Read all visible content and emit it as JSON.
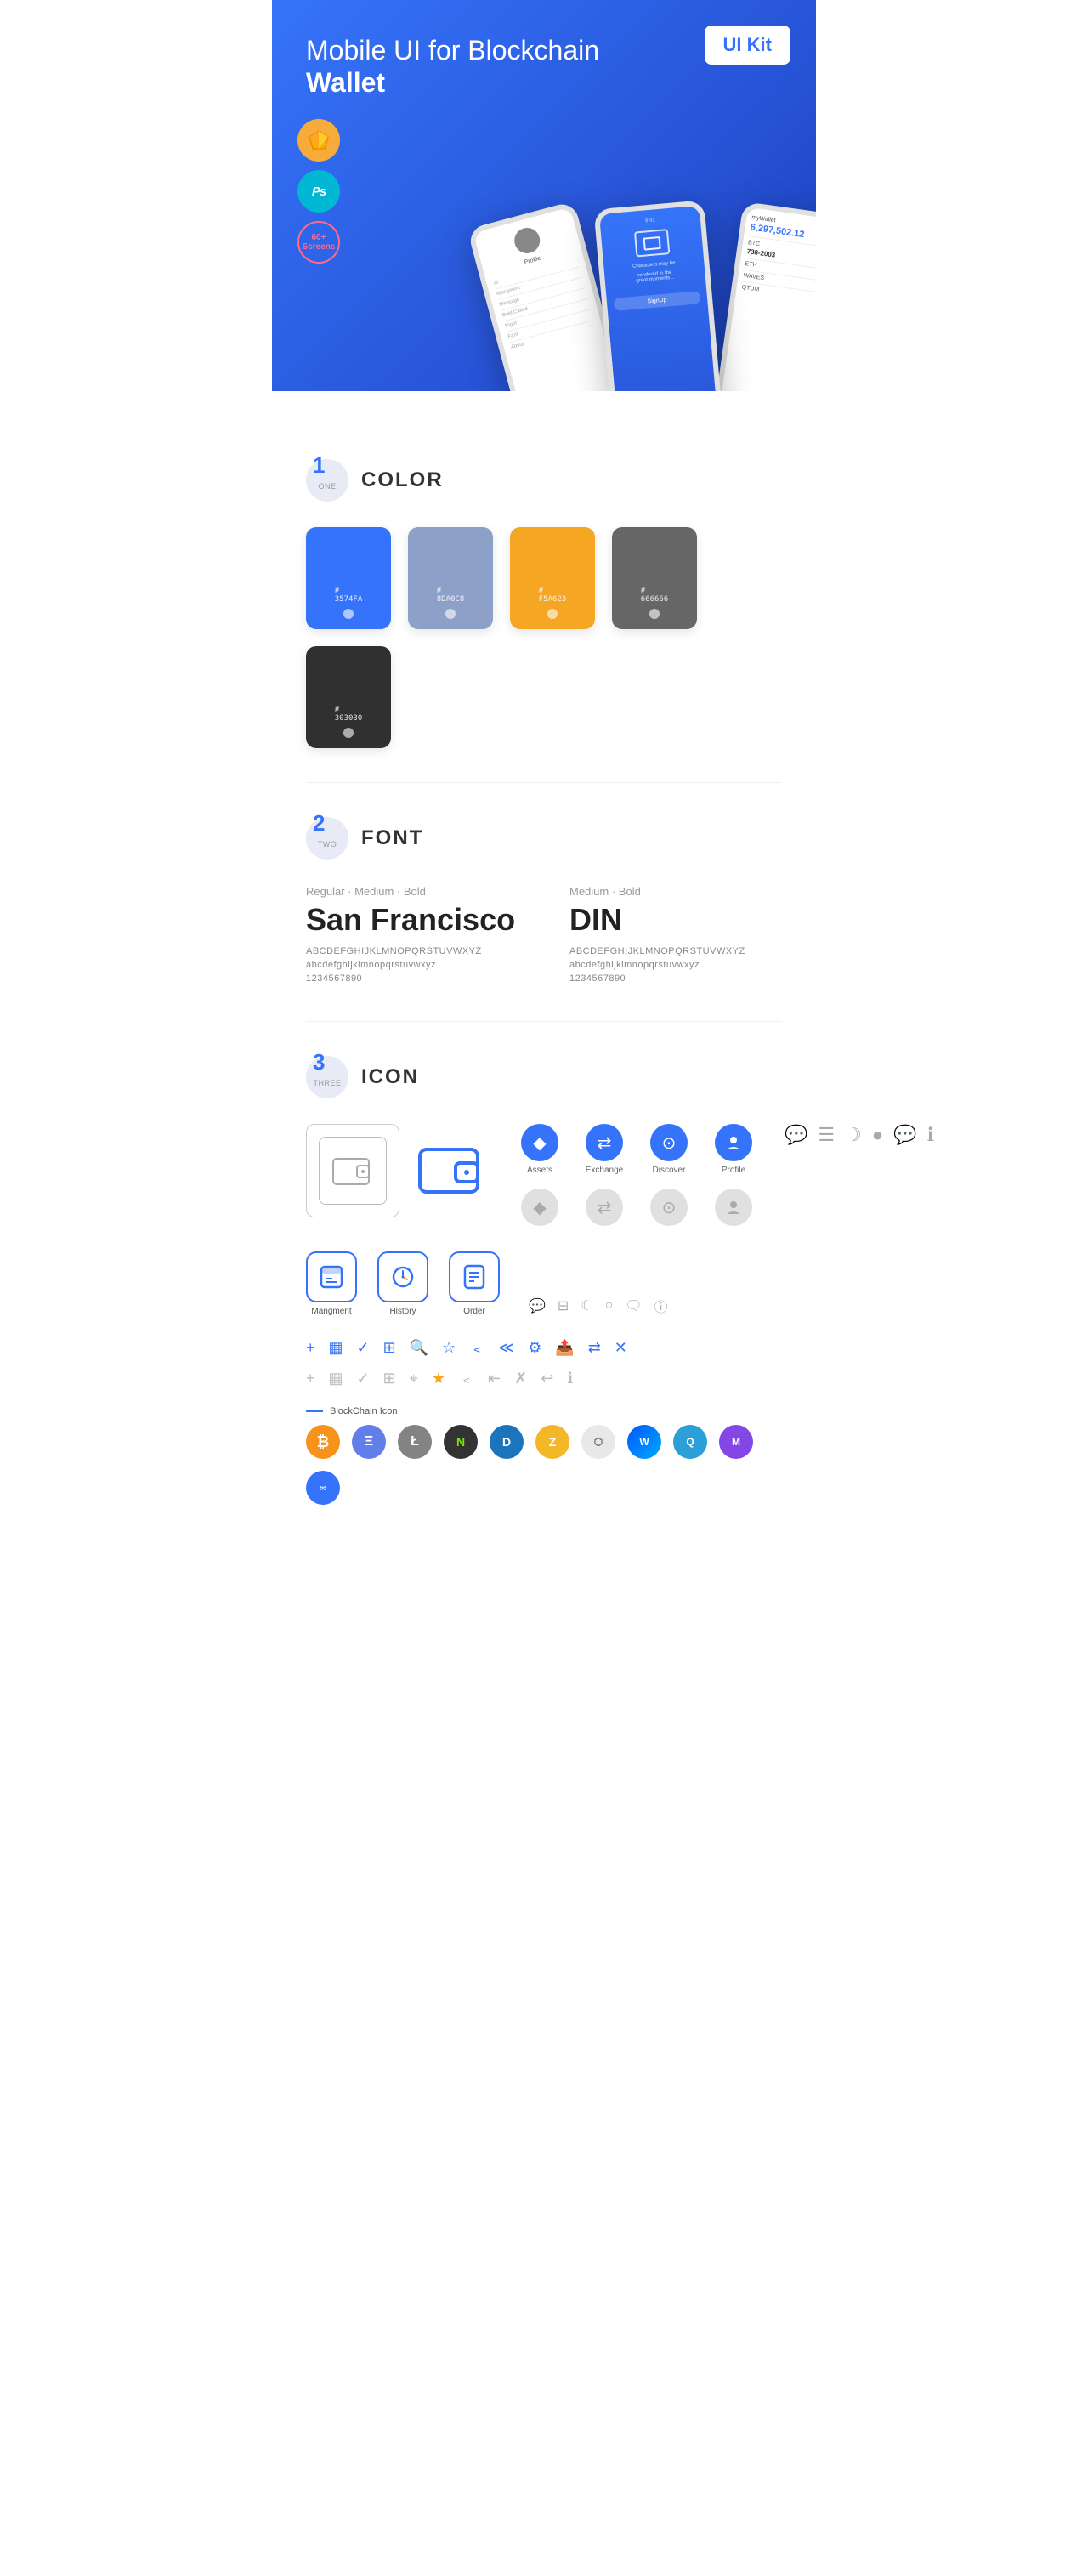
{
  "hero": {
    "title": "Mobile UI for Blockchain ",
    "title_bold": "Wallet",
    "badge": "UI Kit",
    "tools": [
      {
        "name": "Sketch",
        "label": "Sk",
        "bg": "#F7AB38"
      },
      {
        "name": "Photoshop",
        "label": "Ps",
        "bg": "#00B8D4"
      },
      {
        "name": "Screens",
        "label": "60+\nScreens",
        "bg": "transparent"
      }
    ]
  },
  "section_color": {
    "number": "1",
    "sublabel": "ONE",
    "title": "COLOR",
    "colors": [
      {
        "hex": "#3574FA",
        "label": "#\n3574FA"
      },
      {
        "hex": "#8DA0C8",
        "label": "#\n8DA0C8"
      },
      {
        "hex": "#F5A623",
        "label": "#\nF5A623"
      },
      {
        "hex": "#666666",
        "label": "#\n666666"
      },
      {
        "hex": "#303030",
        "label": "#\n303030"
      }
    ]
  },
  "section_font": {
    "number": "2",
    "sublabel": "TWO",
    "title": "FONT",
    "fonts": [
      {
        "style_label": "Regular · Medium · Bold",
        "name": "San Francisco",
        "uppercase": "ABCDEFGHIJKLMNOPQRSTUVWXYZ",
        "lowercase": "abcdefghijklmnopqrstuvwxyz",
        "numbers": "1234567890"
      },
      {
        "style_label": "Medium · Bold",
        "name": "DIN",
        "uppercase": "ABCDEFGHIJKLMNOPQRSTUVWXYZ",
        "lowercase": "abcdefghijklmnopqrstuvwxyz",
        "numbers": "1234567890"
      }
    ]
  },
  "section_icon": {
    "number": "3",
    "sublabel": "THREE",
    "title": "ICON",
    "named_icons": [
      {
        "label": "Assets",
        "type": "circle-blue",
        "symbol": "◆"
      },
      {
        "label": "Exchange",
        "type": "circle-blue",
        "symbol": "♊"
      },
      {
        "label": "Discover",
        "type": "circle-blue",
        "symbol": "⊙"
      },
      {
        "label": "Profile",
        "type": "circle-blue",
        "symbol": "👤"
      }
    ],
    "app_icons": [
      {
        "label": "Mangment",
        "symbol": "▣"
      },
      {
        "label": "History",
        "symbol": "🕐"
      },
      {
        "label": "Order",
        "symbol": "📋"
      }
    ],
    "small_icons_row1": [
      "+",
      "▣",
      "✓",
      "⊞",
      "🔍",
      "☆",
      "<",
      "≪",
      "⚙",
      "📤",
      "⇄",
      "✕"
    ],
    "blockchain_label": "BlockChain Icon",
    "crypto_icons": [
      {
        "symbol": "₿",
        "bg": "#F7931A",
        "label": "BTC"
      },
      {
        "symbol": "Ξ",
        "bg": "#627EEA",
        "label": "ETH"
      },
      {
        "symbol": "Ł",
        "bg": "#838383",
        "label": "LTC"
      },
      {
        "symbol": "N",
        "bg": "#58BF00",
        "label": "NEO"
      },
      {
        "symbol": "D",
        "bg": "#1C75BC",
        "label": "DASH"
      },
      {
        "symbol": "Z",
        "bg": "#F4B728",
        "label": "ZEC"
      },
      {
        "symbol": "⬡",
        "bg": "#E8E8E8",
        "label": "GRID"
      },
      {
        "symbol": "W",
        "bg": "#0055FF",
        "label": "WAVES"
      },
      {
        "symbol": "◈",
        "bg": "#2A9FD8",
        "label": "QTUM"
      },
      {
        "symbol": "M",
        "bg": "#8247E5",
        "label": "MATIC"
      },
      {
        "symbol": "∞",
        "bg": "#3574FA",
        "label": "CHAIN"
      }
    ]
  }
}
